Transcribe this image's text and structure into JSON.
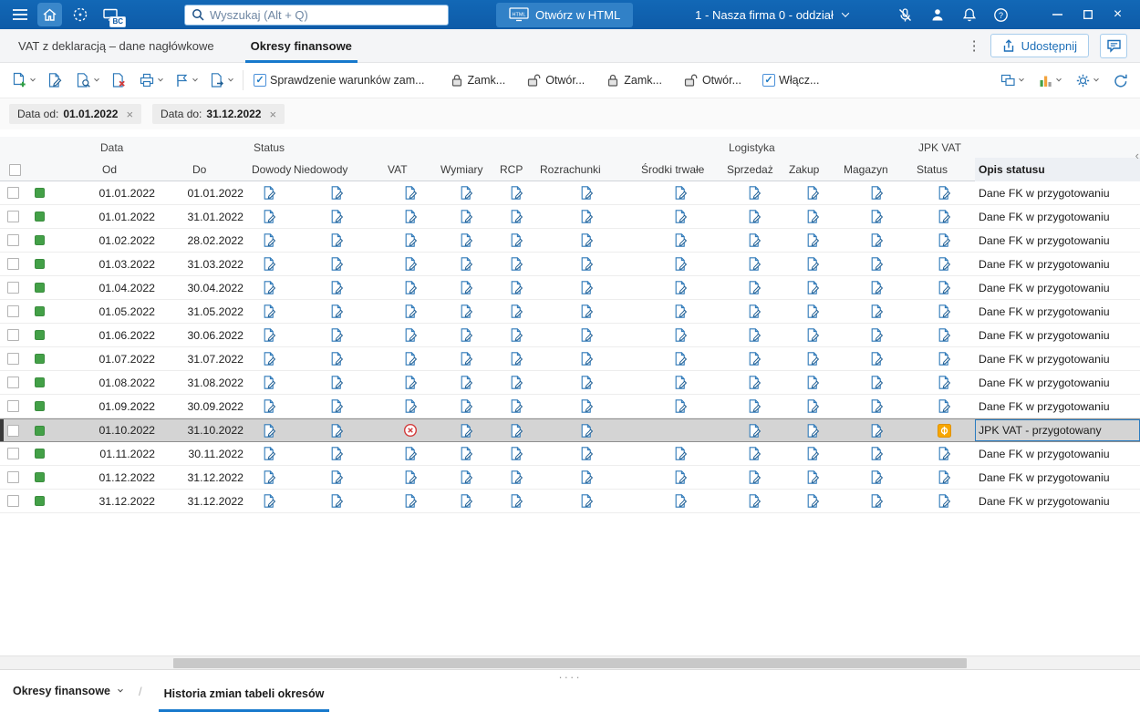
{
  "colors": {
    "topbar_blue": "#1268b6",
    "accent_blue": "#1f7bc4",
    "selection_gray": "#d4d4d4",
    "flag_green": "#43a047",
    "jpk_orange": "#f7a600",
    "blocked_red": "#d23b3b"
  },
  "topbar": {
    "search_placeholder": "Wyszukaj (Alt + Q)",
    "open_html_label": "Otwórz w HTML",
    "company_selector_value": "1 - Nasza firma 0 - oddział",
    "app_badge": "BC"
  },
  "tabbar": {
    "tabs": [
      {
        "label": "VAT z deklaracją – dane nagłówkowe"
      },
      {
        "label": "Okresy finansowe"
      }
    ],
    "share_button_label": "Udostępnij"
  },
  "toolbar": {
    "check_close_conditions_label": "Sprawdzenie warunków zam...",
    "close_label_1": "Zamk...",
    "open_label_1": "Otwór...",
    "close_label_2": "Zamk...",
    "open_label_2": "Otwór...",
    "enable_label": "Włącz..."
  },
  "filters": {
    "date_from_label": "Data od:",
    "date_from_value": "01.01.2022",
    "date_to_label": "Data do:",
    "date_to_value": "31.12.2022"
  },
  "table": {
    "groups": [
      "Data",
      "Status",
      "Logistyka",
      "JPK VAT"
    ],
    "columns": [
      "Od",
      "Do",
      "Dowody",
      "Niedowody",
      "VAT",
      "Wymiary",
      "RCP",
      "Rozrachunki",
      "Środki trwałe",
      "Sprzedaż",
      "Zakup",
      "Magazyn",
      "Status",
      "Opis statusu"
    ],
    "default_cell_icon": "edit-document-icon",
    "rows": [
      {
        "from": "01.01.2022",
        "to": "01.01.2022",
        "status_text": "Dane FK w przygotowaniu"
      },
      {
        "from": "01.01.2022",
        "to": "31.01.2022",
        "status_text": "Dane FK w przygotowaniu"
      },
      {
        "from": "01.02.2022",
        "to": "28.02.2022",
        "status_text": "Dane FK w przygotowaniu"
      },
      {
        "from": "01.03.2022",
        "to": "31.03.2022",
        "status_text": "Dane FK w przygotowaniu"
      },
      {
        "from": "01.04.2022",
        "to": "30.04.2022",
        "status_text": "Dane FK w przygotowaniu"
      },
      {
        "from": "01.05.2022",
        "to": "31.05.2022",
        "status_text": "Dane FK w przygotowaniu"
      },
      {
        "from": "01.06.2022",
        "to": "30.06.2022",
        "status_text": "Dane FK w przygotowaniu"
      },
      {
        "from": "01.07.2022",
        "to": "31.07.2022",
        "status_text": "Dane FK w przygotowaniu"
      },
      {
        "from": "01.08.2022",
        "to": "31.08.2022",
        "status_text": "Dane FK w przygotowaniu"
      },
      {
        "from": "01.09.2022",
        "to": "30.09.2022",
        "status_text": "Dane FK w przygotowaniu"
      },
      {
        "from": "01.10.2022",
        "to": "31.10.2022",
        "status_text": "JPK VAT - przygotowany",
        "selected": true,
        "icons": {
          "vat": "vat-blocked-icon",
          "srodki": "none",
          "jpk": "jpk-in-progress-icon"
        }
      },
      {
        "from": "01.11.2022",
        "to": "30.11.2022",
        "status_text": "Dane FK w przygotowaniu"
      },
      {
        "from": "01.12.2022",
        "to": "31.12.2022",
        "status_text": "Dane FK w przygotowaniu"
      },
      {
        "from": "31.12.2022",
        "to": "31.12.2022",
        "status_text": "Dane FK w przygotowaniu"
      }
    ]
  },
  "footer": {
    "left_tab_label": "Okresy finansowe",
    "history_tab_label": "Historia zmian tabeli okresów"
  }
}
